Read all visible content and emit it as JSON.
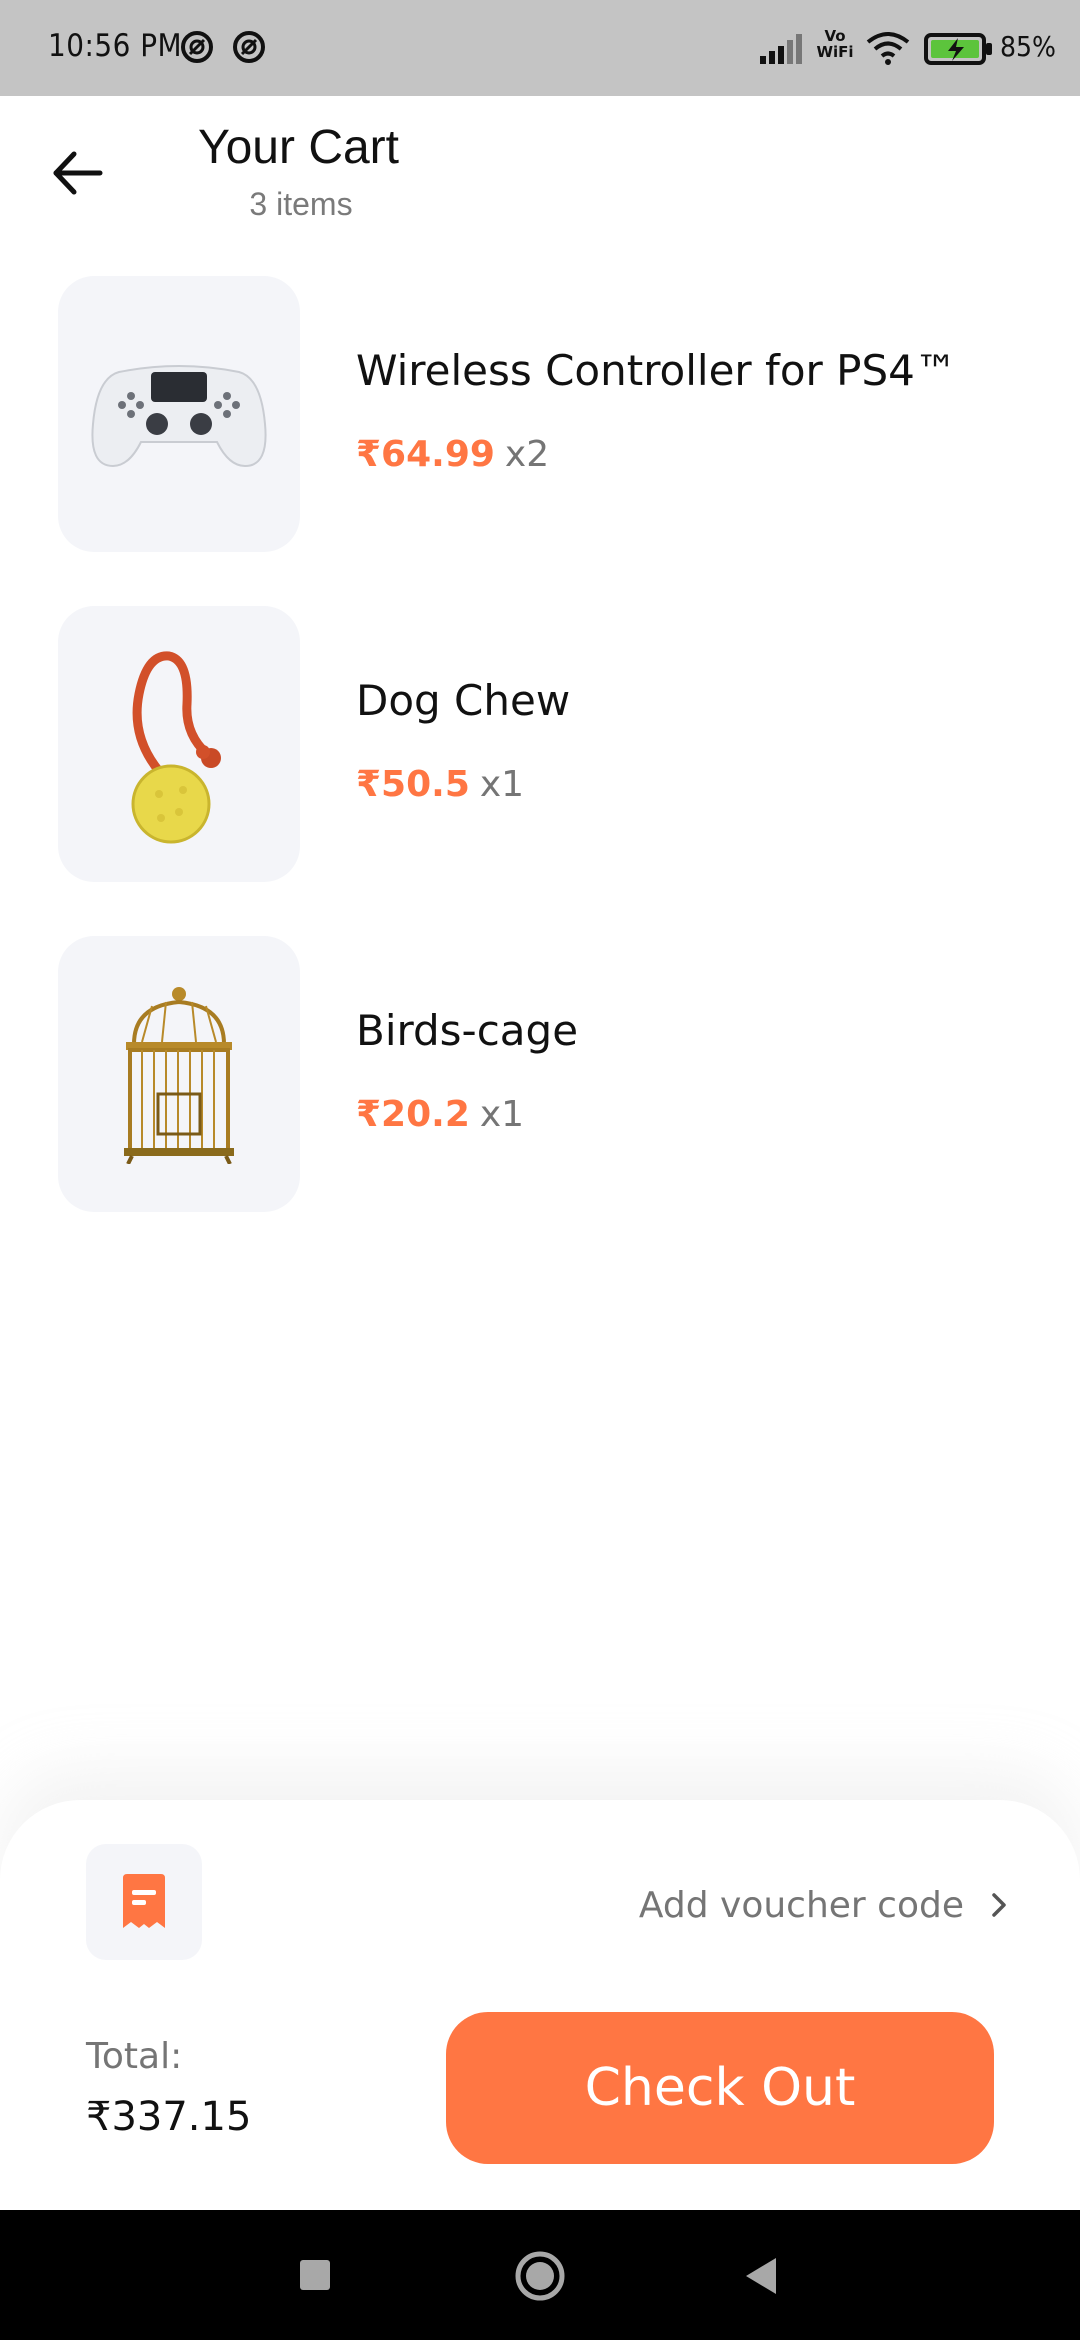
{
  "status_bar": {
    "time": "10:56 PM",
    "vo_wifi_top": "Vo",
    "vo_wifi_bottom": "WiFi",
    "battery_percent": "85%"
  },
  "header": {
    "title": "Your Cart",
    "subtitle": "3 items"
  },
  "cart": {
    "items": [
      {
        "name": "Wireless Controller for PS4™",
        "price": "₹64.99",
        "qty": "x2",
        "image_icon": "game-controller"
      },
      {
        "name": "Dog Chew",
        "price": "₹50.5",
        "qty": "x1",
        "image_icon": "dog-chew-ball"
      },
      {
        "name": "Birds-cage",
        "price": "₹20.2",
        "qty": "x1",
        "image_icon": "bird-cage"
      }
    ]
  },
  "checkout": {
    "voucher_label": "Add voucher code",
    "total_label": "Total:",
    "total_value": "₹337.15",
    "button_label": "Check Out"
  },
  "colors": {
    "accent": "#ff7643",
    "thumb_bg": "#f4f5f9",
    "muted_text": "#757575",
    "status_bar_bg": "#c4c4c4"
  }
}
